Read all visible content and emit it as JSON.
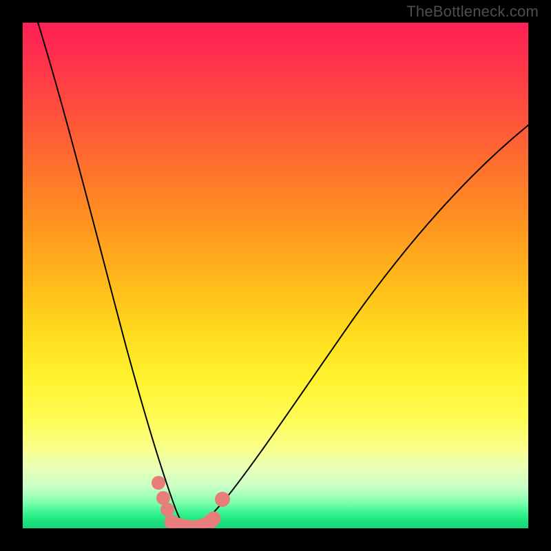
{
  "watermark": "TheBottleneck.com",
  "colors": {
    "background": "#000000",
    "curve": "#000000",
    "marker": "#e77e7b",
    "gradient_top": "#ff1f55",
    "gradient_bottom": "#16d676"
  },
  "chart_data": {
    "type": "line",
    "title": "",
    "xlabel": "",
    "ylabel": "",
    "xlim": [
      0,
      100
    ],
    "ylim": [
      0,
      100
    ],
    "grid": false,
    "series": [
      {
        "name": "left-curve",
        "x": [
          2,
          5,
          8,
          11,
          14,
          17,
          20,
          23,
          25,
          27,
          29,
          30
        ],
        "y": [
          100,
          85,
          71,
          58,
          46,
          35,
          25,
          16,
          10,
          5,
          2,
          0
        ]
      },
      {
        "name": "right-curve",
        "x": [
          33,
          36,
          40,
          45,
          50,
          56,
          63,
          72,
          82,
          92,
          100
        ],
        "y": [
          0,
          3,
          8,
          15,
          23,
          32,
          42,
          53,
          64,
          74,
          81
        ]
      }
    ],
    "markers": {
      "name": "highlighted-points",
      "color": "#e77e7b",
      "points": [
        {
          "x": 25.5,
          "y": 9.0
        },
        {
          "x": 26.8,
          "y": 6.0
        },
        {
          "x": 27.6,
          "y": 4.0
        },
        {
          "x": 29.0,
          "y": 1.2
        },
        {
          "x": 31.0,
          "y": 0.6
        },
        {
          "x": 33.0,
          "y": 0.6
        },
        {
          "x": 35.0,
          "y": 1.5
        },
        {
          "x": 36.5,
          "y": 3.5
        },
        {
          "x": 38.0,
          "y": 6.0
        }
      ]
    },
    "notes": "Background is a continuous vertical color gradient from red (high bottleneck) through orange/yellow to green (low bottleneck). Two black curves form a V shape with minimum near x≈31. Salmon-colored markers trace the bottom of the V. Axes have no visible tick labels; values are estimated on a 0–100 normalized scale."
  }
}
